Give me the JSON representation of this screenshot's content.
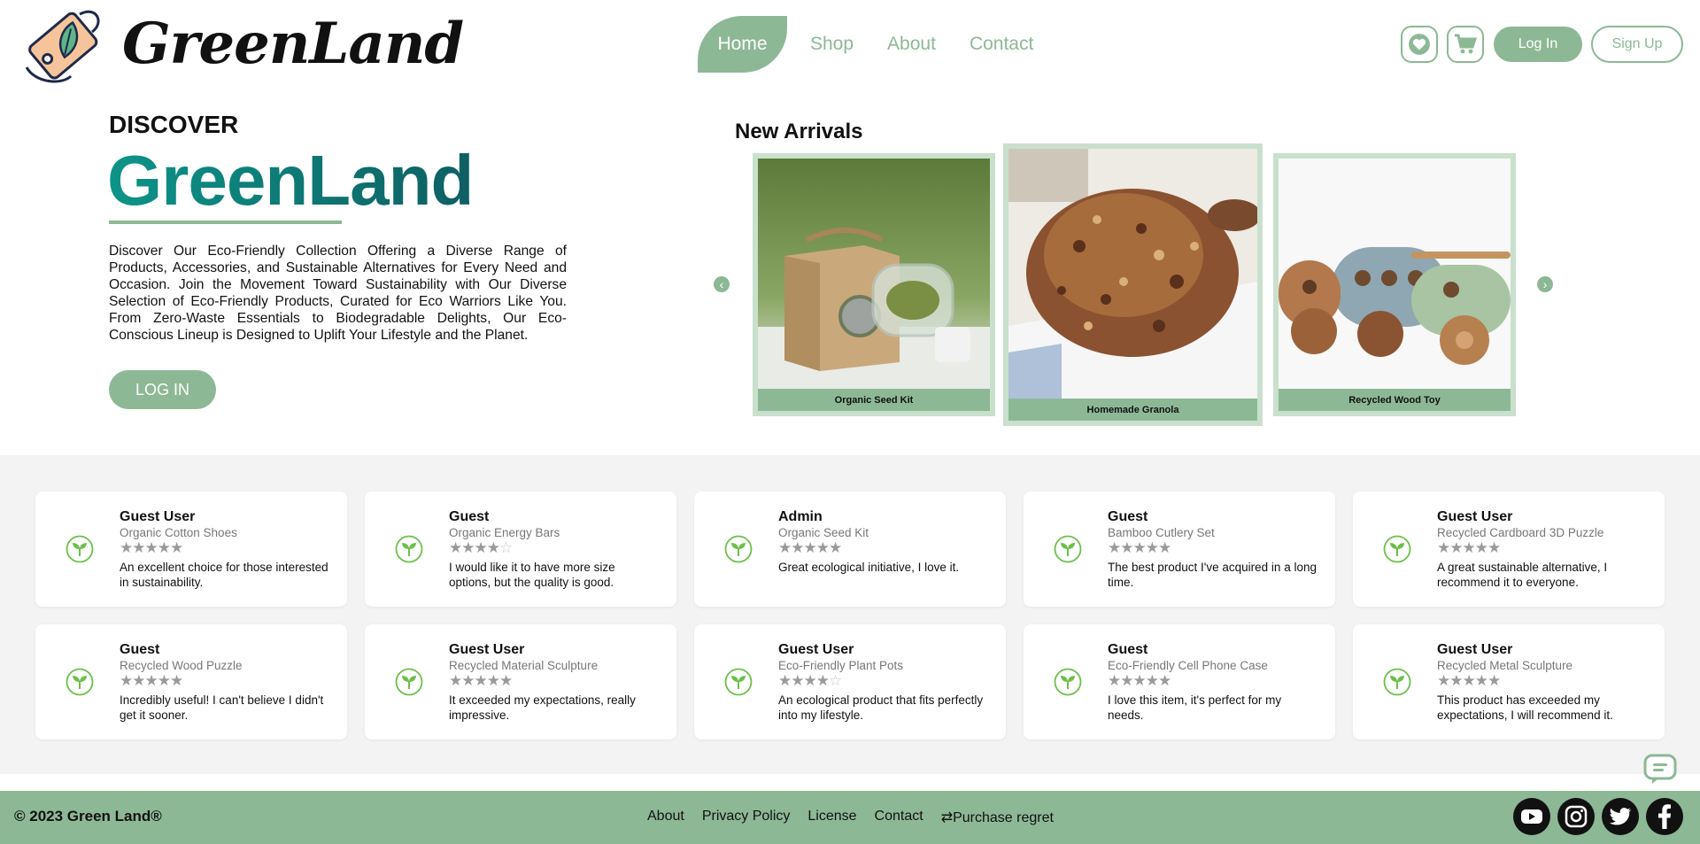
{
  "header": {
    "logo_text": "GreenLand",
    "nav": [
      "Home",
      "Shop",
      "About",
      "Contact"
    ],
    "login_label": "Log In",
    "signup_label": "Sign Up"
  },
  "hero": {
    "eyebrow": "DISCOVER",
    "brand": "GreenLand",
    "description": "Discover Our Eco-Friendly Collection Offering a Diverse Range of Products, Accessories, and Sustainable Alternatives for Every Need and Occasion. Join the Movement Toward Sustainability with Our Diverse Selection of Eco-Friendly Products, Curated for Eco Warriors Like You. From Zero-Waste Essentials to Biodegradable Delights, Our Eco-Conscious Lineup is Designed to Uplift Your Lifestyle and the Planet.",
    "login_label": "LOG IN"
  },
  "arrivals": {
    "title": "New Arrivals",
    "items": [
      {
        "caption": "Organic Seed Kit"
      },
      {
        "caption": "Homemade Granola"
      },
      {
        "caption": "Recycled Wood Toy"
      }
    ]
  },
  "reviews": [
    {
      "name": "Guest User",
      "product": "Organic Cotton Shoes",
      "rating": 5,
      "comment": "An excellent choice for those interested in sustainability."
    },
    {
      "name": "Guest",
      "product": "Organic Energy Bars",
      "rating": 4,
      "comment": "I would like it to have more size options, but the quality is good."
    },
    {
      "name": "Admin",
      "product": "Organic Seed Kit",
      "rating": 5,
      "comment": "Great ecological initiative, I love it."
    },
    {
      "name": "Guest",
      "product": "Bamboo Cutlery Set",
      "rating": 5,
      "comment": "The best product I've acquired in a long time."
    },
    {
      "name": "Guest User",
      "product": "Recycled Cardboard 3D Puzzle",
      "rating": 5,
      "comment": "A great sustainable alternative, I recommend it to everyone."
    },
    {
      "name": "Guest",
      "product": "Recycled Wood Puzzle",
      "rating": 5,
      "comment": "Incredibly useful! I can't believe I didn't get it sooner."
    },
    {
      "name": "Guest User",
      "product": "Recycled Material Sculpture",
      "rating": 5,
      "comment": "It exceeded my expectations, really impressive."
    },
    {
      "name": "Guest User",
      "product": "Eco-Friendly Plant Pots",
      "rating": 4,
      "comment": "An ecological product that fits perfectly into my lifestyle."
    },
    {
      "name": "Guest",
      "product": "Eco-Friendly Cell Phone Case",
      "rating": 5,
      "comment": "I love this item, it's perfect for my needs."
    },
    {
      "name": "Guest User",
      "product": "Recycled Metal Sculpture",
      "rating": 5,
      "comment": "This product has exceeded my expectations, I will recommend it."
    }
  ],
  "footer": {
    "copyright": "© 2023 Green Land®",
    "links": [
      "About",
      "Privacy Policy",
      "License",
      "Contact",
      "⇄Purchase regret"
    ]
  },
  "social_icons": [
    "youtube-icon",
    "instagram-icon",
    "twitter-icon",
    "facebook-icon"
  ],
  "colors": {
    "accent": "#8db896",
    "brand_start": "#0d9488",
    "brand_end": "#0e5f63",
    "leaf": "#6cc04a"
  }
}
